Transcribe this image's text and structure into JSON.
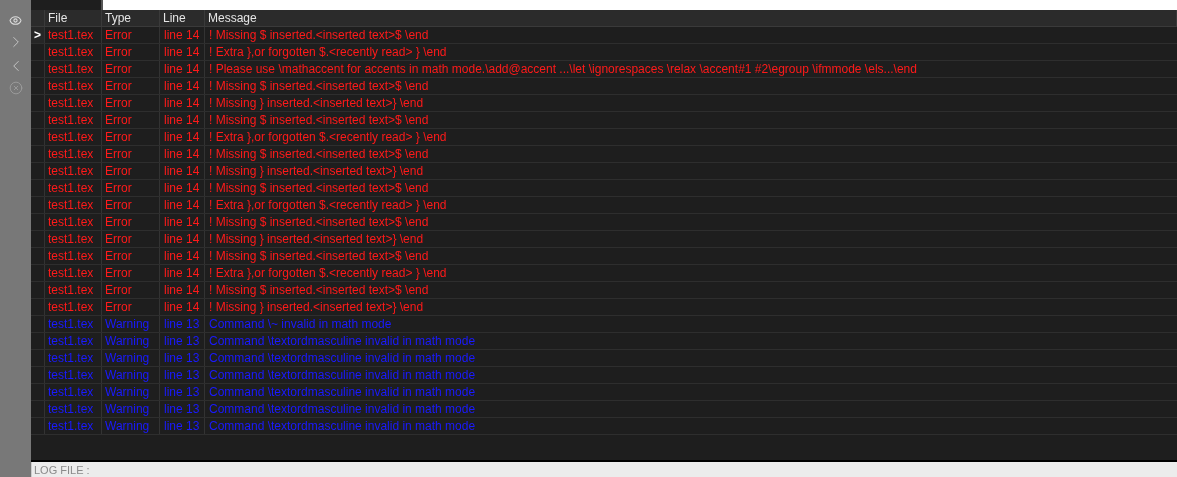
{
  "table": {
    "columns": [
      "File",
      "Type",
      "Line",
      "Message"
    ],
    "current_marker": ">",
    "rows": [
      {
        "kind": "error",
        "current": true,
        "file": "test1.tex",
        "type": "Error",
        "line": "line 14",
        "message": "! Missing $ inserted.<inserted text>$ \\end"
      },
      {
        "kind": "error",
        "current": false,
        "file": "test1.tex",
        "type": "Error",
        "line": "line 14",
        "message": "! Extra },or forgotten $.<recently read> } \\end"
      },
      {
        "kind": "error",
        "current": false,
        "file": "test1.tex",
        "type": "Error",
        "line": "line 14",
        "message": "! Please use \\mathaccent for accents in math mode.\\add@accent ...\\let \\ignorespaces \\relax \\accent#1 #2\\egroup \\ifmmode \\els...\\end"
      },
      {
        "kind": "error",
        "current": false,
        "file": "test1.tex",
        "type": "Error",
        "line": "line 14",
        "message": "! Missing $ inserted.<inserted text>$ \\end"
      },
      {
        "kind": "error",
        "current": false,
        "file": "test1.tex",
        "type": "Error",
        "line": "line 14",
        "message": "! Missing } inserted.<inserted text>} \\end"
      },
      {
        "kind": "error",
        "current": false,
        "file": "test1.tex",
        "type": "Error",
        "line": "line 14",
        "message": "! Missing $ inserted.<inserted text>$ \\end"
      },
      {
        "kind": "error",
        "current": false,
        "file": "test1.tex",
        "type": "Error",
        "line": "line 14",
        "message": "! Extra },or forgotten $.<recently read> } \\end"
      },
      {
        "kind": "error",
        "current": false,
        "file": "test1.tex",
        "type": "Error",
        "line": "line 14",
        "message": "! Missing $ inserted.<inserted text>$ \\end"
      },
      {
        "kind": "error",
        "current": false,
        "file": "test1.tex",
        "type": "Error",
        "line": "line 14",
        "message": "! Missing } inserted.<inserted text>} \\end"
      },
      {
        "kind": "error",
        "current": false,
        "file": "test1.tex",
        "type": "Error",
        "line": "line 14",
        "message": "! Missing $ inserted.<inserted text>$ \\end"
      },
      {
        "kind": "error",
        "current": false,
        "file": "test1.tex",
        "type": "Error",
        "line": "line 14",
        "message": "! Extra },or forgotten $.<recently read> } \\end"
      },
      {
        "kind": "error",
        "current": false,
        "file": "test1.tex",
        "type": "Error",
        "line": "line 14",
        "message": "! Missing $ inserted.<inserted text>$ \\end"
      },
      {
        "kind": "error",
        "current": false,
        "file": "test1.tex",
        "type": "Error",
        "line": "line 14",
        "message": "! Missing } inserted.<inserted text>} \\end"
      },
      {
        "kind": "error",
        "current": false,
        "file": "test1.tex",
        "type": "Error",
        "line": "line 14",
        "message": "! Missing $ inserted.<inserted text>$ \\end"
      },
      {
        "kind": "error",
        "current": false,
        "file": "test1.tex",
        "type": "Error",
        "line": "line 14",
        "message": "! Extra },or forgotten $.<recently read> } \\end"
      },
      {
        "kind": "error",
        "current": false,
        "file": "test1.tex",
        "type": "Error",
        "line": "line 14",
        "message": "! Missing $ inserted.<inserted text>$ \\end"
      },
      {
        "kind": "error",
        "current": false,
        "file": "test1.tex",
        "type": "Error",
        "line": "line 14",
        "message": "! Missing } inserted.<inserted text>} \\end"
      },
      {
        "kind": "warning",
        "current": false,
        "file": "test1.tex",
        "type": "Warning",
        "line": "line 13",
        "message": "Command \\~ invalid in math mode"
      },
      {
        "kind": "warning",
        "current": false,
        "file": "test1.tex",
        "type": "Warning",
        "line": "line 13",
        "message": "Command \\textordmasculine invalid in math mode"
      },
      {
        "kind": "warning",
        "current": false,
        "file": "test1.tex",
        "type": "Warning",
        "line": "line 13",
        "message": "Command \\textordmasculine invalid in math mode"
      },
      {
        "kind": "warning",
        "current": false,
        "file": "test1.tex",
        "type": "Warning",
        "line": "line 13",
        "message": "Command \\textordmasculine invalid in math mode"
      },
      {
        "kind": "warning",
        "current": false,
        "file": "test1.tex",
        "type": "Warning",
        "line": "line 13",
        "message": "Command \\textordmasculine invalid in math mode"
      },
      {
        "kind": "warning",
        "current": false,
        "file": "test1.tex",
        "type": "Warning",
        "line": "line 13",
        "message": "Command \\textordmasculine invalid in math mode"
      },
      {
        "kind": "warning",
        "current": false,
        "file": "test1.tex",
        "type": "Warning",
        "line": "line 13",
        "message": "Command \\textordmasculine invalid in math mode"
      }
    ]
  },
  "status_bar": {
    "label": "LOG FILE :"
  }
}
